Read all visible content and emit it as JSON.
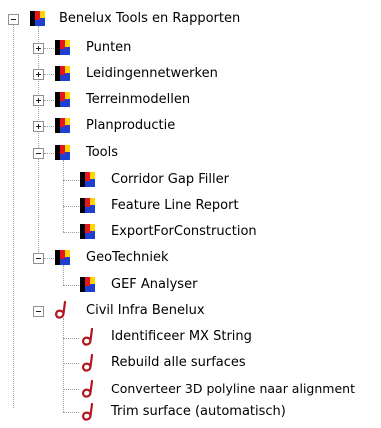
{
  "tree": {
    "root": {
      "label": "Benelux Tools en Rapporten",
      "icon": "flag-icon",
      "expanded": true,
      "children": [
        {
          "label": "Punten",
          "icon": "flag-icon",
          "expanded": false
        },
        {
          "label": "Leidingennetwerken",
          "icon": "flag-icon",
          "expanded": false
        },
        {
          "label": "Terreinmodellen",
          "icon": "flag-icon",
          "expanded": false
        },
        {
          "label": "Planproductie",
          "icon": "flag-icon",
          "expanded": false
        },
        {
          "label": "Tools",
          "icon": "flag-icon",
          "expanded": true,
          "children": [
            {
              "label": "Corridor Gap Filler",
              "icon": "flag-icon"
            },
            {
              "label": "Feature Line Report",
              "icon": "flag-icon"
            },
            {
              "label": "ExportForConstruction",
              "icon": "flag-icon"
            }
          ]
        },
        {
          "label": "GeoTechniek",
          "icon": "flag-icon",
          "expanded": true,
          "children": [
            {
              "label": "GEF Analyser",
              "icon": "flag-icon"
            }
          ]
        }
      ]
    },
    "civil": {
      "label": "Civil Infra Benelux",
      "icon": "civil3d-icon",
      "expanded": true,
      "children": [
        {
          "label": "Identificeer MX String",
          "icon": "civil3d-icon"
        },
        {
          "label": "Rebuild alle surfaces",
          "icon": "civil3d-icon"
        },
        {
          "label": "Converteer 3D polyline naar alignment",
          "icon": "civil3d-icon"
        },
        {
          "label": "Trim surface (automatisch)",
          "icon": "civil3d-icon"
        }
      ]
    }
  },
  "colors": {
    "flag_black": "#000000",
    "flag_red": "#e8141b",
    "flag_yellow": "#ffd400",
    "flag_blue": "#1e3fd1",
    "civil_icon": "#b0171f",
    "tree_line": "#a0a0a0",
    "expander_border": "#919191"
  }
}
